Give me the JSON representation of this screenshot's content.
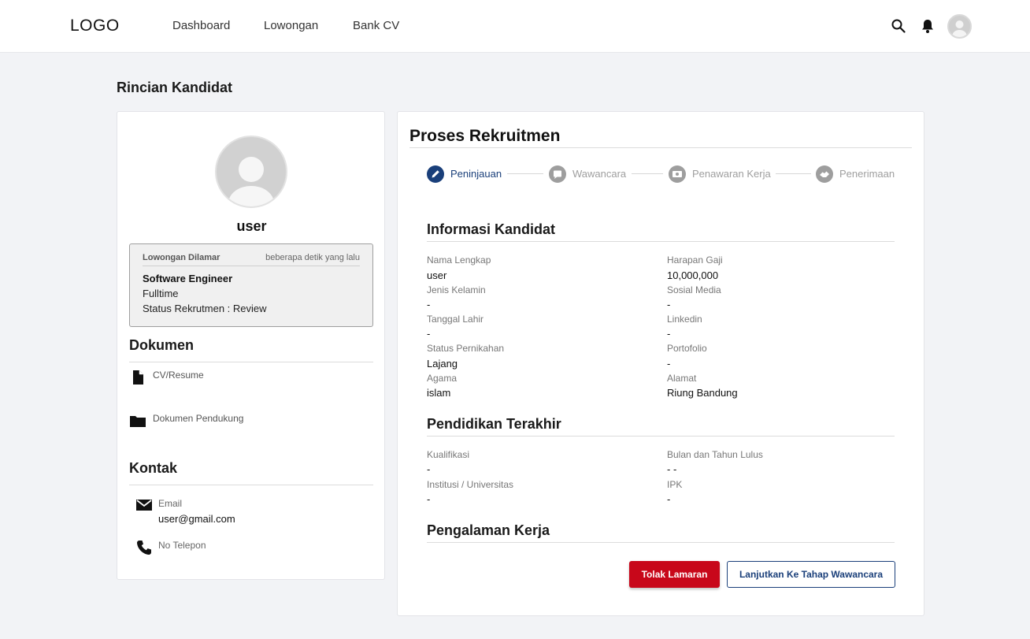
{
  "header": {
    "logo": "LOGO",
    "nav": [
      "Dashboard",
      "Lowongan",
      "Bank CV"
    ]
  },
  "page": {
    "title": "Rincian Kandidat"
  },
  "candidate": {
    "name": "user",
    "applied": {
      "heading": "Lowongan Dilamar",
      "time": "beberapa detik yang lalu",
      "job": "Software Engineer",
      "type": "Fulltime",
      "status": "Status Rekrutmen : Review"
    }
  },
  "documents": {
    "heading": "Dokumen",
    "items": [
      "CV/Resume",
      "Dokumen Pendukung"
    ]
  },
  "contact": {
    "heading": "Kontak",
    "email_label": "Email",
    "email_value": "user@gmail.com",
    "phone_label": "No Telepon"
  },
  "process": {
    "title": "Proses Rekruitmen",
    "steps": [
      "Peninjauan",
      "Wawancara",
      "Penawaran Kerja",
      "Penerimaan"
    ],
    "active_step": 0
  },
  "info": {
    "heading": "Informasi Kandidat",
    "fields": [
      {
        "label": "Nama Lengkap",
        "value": "user"
      },
      {
        "label": "Harapan Gaji",
        "value": "10,000,000"
      },
      {
        "label": "Jenis Kelamin",
        "value": "-"
      },
      {
        "label": "Sosial Media",
        "value": "-"
      },
      {
        "label": "Tanggal Lahir",
        "value": "-"
      },
      {
        "label": "Linkedin",
        "value": "-"
      },
      {
        "label": "Status Pernikahan",
        "value": "Lajang"
      },
      {
        "label": "Portofolio",
        "value": "-"
      },
      {
        "label": "Agama",
        "value": "islam"
      },
      {
        "label": "Alamat",
        "value": "Riung Bandung"
      }
    ]
  },
  "education": {
    "heading": "Pendidikan Terakhir",
    "fields": [
      {
        "label": "Kualifikasi",
        "value": "-"
      },
      {
        "label": "Bulan dan Tahun Lulus",
        "value": "- -"
      },
      {
        "label": "Institusi / Universitas",
        "value": "-"
      },
      {
        "label": "IPK",
        "value": "-"
      }
    ]
  },
  "experience": {
    "heading": "Pengalaman Kerja"
  },
  "actions": {
    "reject": "Tolak Lamaran",
    "next": "Lanjutkan Ke Tahap Wawancara"
  },
  "colors": {
    "active_step": "#1a3f7a",
    "inactive_step": "#9e9e9e",
    "reject": "#c8071a"
  }
}
